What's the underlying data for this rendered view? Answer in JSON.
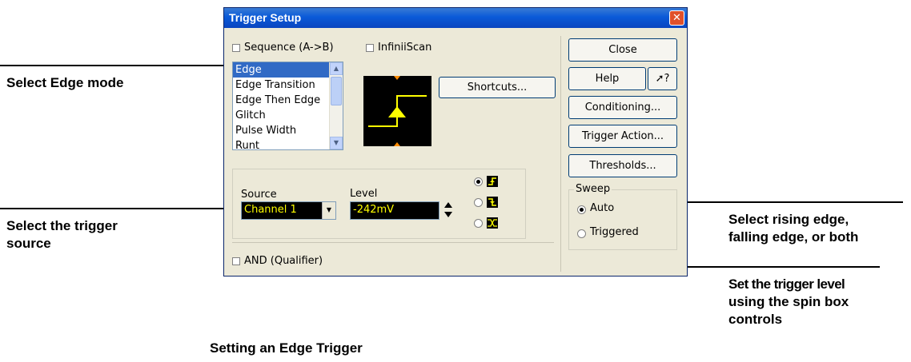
{
  "dialog": {
    "title": "Trigger Setup",
    "sequence_label": "Sequence (A->B)",
    "infiniiscan_label": "InfiniiScan",
    "mode_list": [
      "Edge",
      "Edge Transition",
      "Edge Then Edge",
      "Glitch",
      "Pulse Width",
      "Runt"
    ],
    "selected_mode": "Edge",
    "shortcuts_label": "Shortcuts...",
    "source_label": "Source",
    "source_value": "Channel 1",
    "level_label": "Level",
    "level_value": "-242mV",
    "slope_options": [
      "rising-edge",
      "falling-edge",
      "either-edge"
    ],
    "slope_selected": "rising-edge",
    "and_qualifier_label": "AND (Qualifier)",
    "buttons": {
      "close": "Close",
      "help": "Help",
      "whats_this": "?",
      "conditioning": "Conditioning...",
      "trigger_action": "Trigger Action...",
      "thresholds": "Thresholds..."
    },
    "sweep": {
      "label": "Sweep",
      "options": [
        "Auto",
        "Triggered"
      ],
      "selected": "Auto"
    }
  },
  "annotations": {
    "edge_mode": "Select Edge mode",
    "trigger_source_1": "Select the trigger",
    "trigger_source_2": "source",
    "slope_1": "Select rising edge,",
    "slope_2": "falling edge, or both",
    "level_1": "Set the trigger level",
    "level_2": "using the spin box",
    "level_3": "controls"
  },
  "caption": "Setting an Edge Trigger",
  "colors": {
    "title_bar": "#0a5ad8",
    "dialog_bg": "#ece9d8",
    "selection": "#316ac5",
    "display_bg": "#000000",
    "display_text": "#ffff00",
    "preview_trace": "#ffff00",
    "preview_marker": "#ff8c00"
  }
}
